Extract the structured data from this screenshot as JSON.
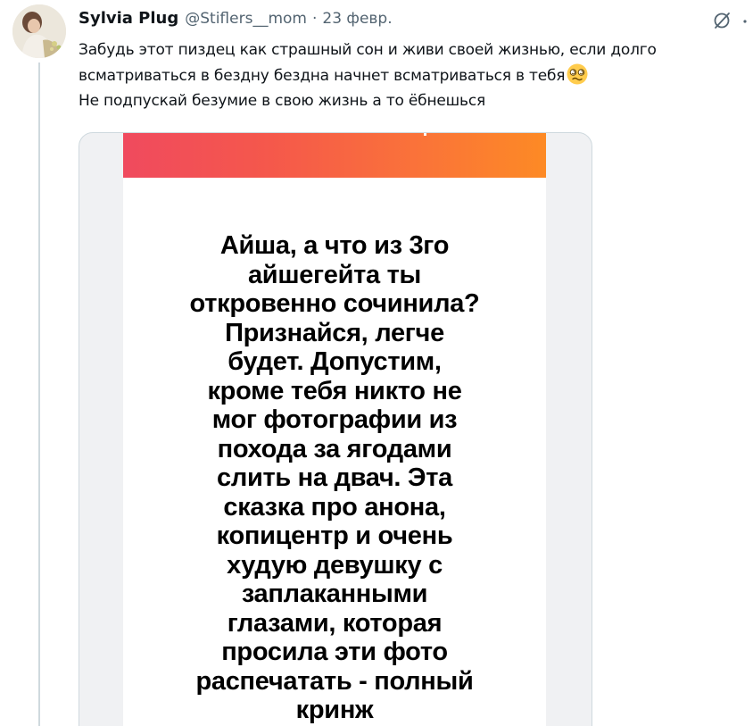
{
  "author": {
    "name": "Sylvia Plug",
    "handle": "@Stiflers__mom",
    "separator": "·",
    "date": "23 февр."
  },
  "icons": {
    "avatar": "avatar",
    "grok": "grok-icon",
    "more": "more-icon",
    "emoji": "woozy-face-emoji"
  },
  "post": {
    "lines": [
      "Забудь этот пиздец как страшный сон и живи своей жизнью, если долго",
      "всматриваться в бездну бездна начнет всматриваться в тебя",
      "Не подпускай безумие в свою жизнь а то ёбнешься"
    ]
  },
  "story": {
    "lines": [
      "Айша, а что из 3го",
      "айшегейта ты",
      "откровенно сочинила?",
      "Признайся, легче",
      "будет. Допустим,",
      "кроме тебя никто не",
      "мог фотографии из",
      "похода за ягодами",
      "слить на двач. Эта",
      "сказка про анона,",
      "копицентр и очень",
      "худую девушку с",
      "заплаканными",
      "глазами, которая",
      "просила эти фото",
      "распечатать - полный",
      "кринж"
    ]
  },
  "colors": {
    "text": "#0f1419",
    "secondary": "#536471",
    "banner_start": "#f04a5e",
    "banner_end": "#fd8a25",
    "thread_line": "#cfd9de"
  }
}
